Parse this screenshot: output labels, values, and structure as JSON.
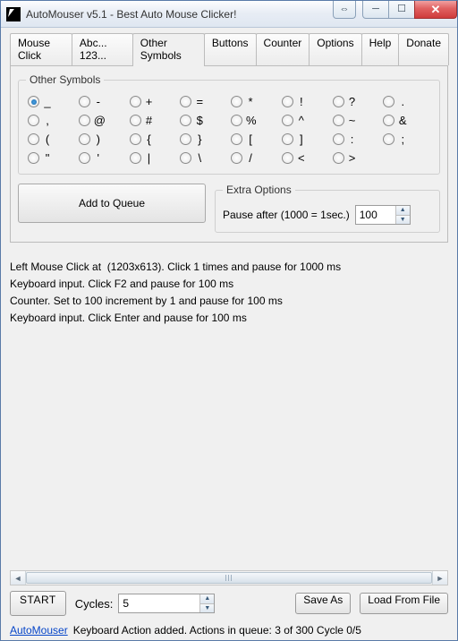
{
  "window": {
    "title": "AutoMouser v5.1 - Best Auto Mouse Clicker!"
  },
  "tabs": [
    "Mouse Click",
    "Abc... 123...",
    "Other Symbols",
    "Buttons",
    "Counter",
    "Options",
    "Help",
    "Donate"
  ],
  "active_tab": 2,
  "symbols_legend": "Other Symbols",
  "symbols": [
    "_",
    "-",
    "+",
    "=",
    "*",
    "!",
    "?",
    ".",
    ",",
    "@",
    "#",
    "$",
    "%",
    "^",
    "~",
    "&",
    "(",
    ")",
    "{",
    "}",
    "[",
    "]",
    ":",
    ";",
    "\"",
    "'",
    "|",
    "\\",
    "/",
    "<",
    ">"
  ],
  "symbol_selected": 0,
  "add_button": "Add to Queue",
  "extra": {
    "legend": "Extra Options",
    "label": "Pause after (1000 = 1sec.)",
    "value": "100"
  },
  "queue": [
    "Left Mouse Click at  (1203x613). Click 1 times and pause for 1000 ms",
    "Keyboard input. Click F2 and pause for 100 ms",
    "Counter. Set to 100 increment by 1 and pause for 100 ms",
    "Keyboard input. Click Enter and pause for 100 ms"
  ],
  "start": "START",
  "cycles": {
    "label": "Cycles:",
    "value": "5"
  },
  "saveas": "Save As",
  "loadfile": "Load From File",
  "status": {
    "link": "AutoMouser",
    "text": "Keyboard Action added. Actions in queue: 3 of 300   Cycle 0/5"
  }
}
